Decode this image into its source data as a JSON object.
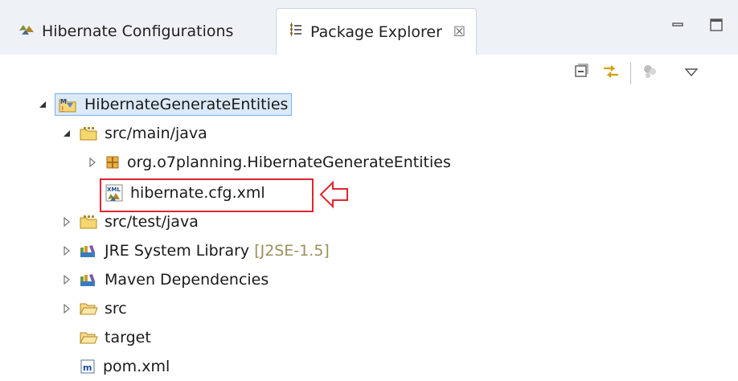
{
  "tabs": {
    "hibernate_label": "Hibernate Configurations",
    "package_label": "Package Explorer",
    "close_glyph": "☒"
  },
  "tree": {
    "project": "HibernateGenerateEntities",
    "src_main": "src/main/java",
    "package": "org.o7planning.HibernateGenerateEntities",
    "config_file": "hibernate.cfg.xml",
    "src_test": "src/test/java",
    "jre_label": "JRE System Library",
    "jre_version": "[J2SE-1.5]",
    "maven": "Maven Dependencies",
    "src": "src",
    "target": "target",
    "pom": "pom.xml"
  },
  "colors": {
    "highlight_box": "#e0262d",
    "selection_bg": "#dbe9f8",
    "version_text": "#9c8f5a"
  }
}
